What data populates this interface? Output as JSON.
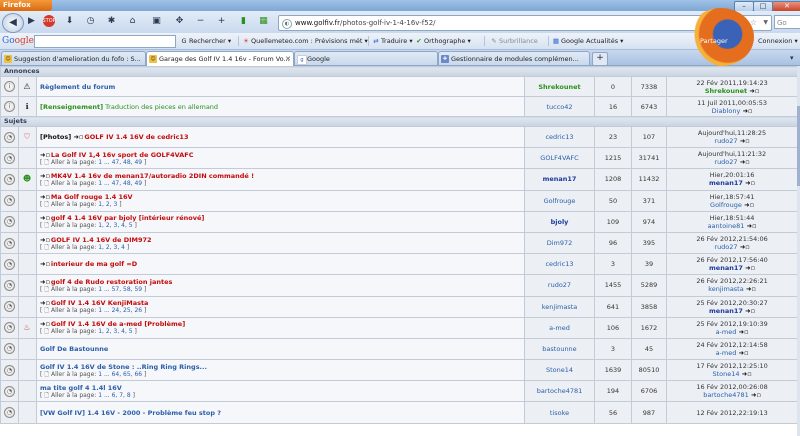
{
  "window": {
    "app_button": "Firefox",
    "minimize": "–",
    "maximize": "□",
    "close": "✕"
  },
  "nav": {
    "url_host": "www.golfiv.fr",
    "url_path": "/photos-golf-iv-1-4-16v-f52/",
    "search_placeholder": "Go"
  },
  "google_toolbar": {
    "logo_g": "Go",
    "logo_rest": "ogle",
    "search_value": "",
    "items": [
      {
        "icon": "G",
        "label": "Rechercher ▾"
      },
      {
        "icon": "☀",
        "label": "Quellemeteo.com : Prévisions mét ▾"
      },
      {
        "icon": "⇄",
        "label": "Traduire ▾"
      },
      {
        "icon": "✔",
        "label": "Orthographe ▾"
      },
      {
        "icon": "✎",
        "label": "Surbrillance"
      },
      {
        "icon": "▦",
        "label": "Google Actualités ▾"
      }
    ],
    "profile_label": "Partager",
    "connexion": "Connexion ▾"
  },
  "tabs": [
    {
      "label": "Suggestion d'amelioration du fofo : S...",
      "active": false
    },
    {
      "label": "Garage des Golf IV 1.4 16v - Forum Vo...",
      "active": true
    },
    {
      "label": "Google",
      "active": false
    },
    {
      "label": "Gestionnaire de modules complémen...",
      "active": false
    }
  ],
  "forum": {
    "announce_header": "Annonces",
    "subjects_header": "Sujets",
    "announcements": [
      {
        "icon_type": "⚠",
        "title": "Règlement du forum",
        "title_style": "blue",
        "desc": "",
        "author": "Shrekounet",
        "author_style": "au2",
        "replies": "0",
        "views": "7338",
        "last_date": "22 Fév 2011,19:14:23",
        "last_user": "Shrekounet",
        "last_style": "au2"
      },
      {
        "icon_type": "ℹ",
        "title": "[Renseignement]",
        "title_style": "green",
        "desc": "Traduction des pieces en allemand",
        "author": "tucco42",
        "author_style": "plain",
        "replies": "16",
        "views": "6743",
        "last_date": "11 Juil 2011,00:05:53",
        "last_user": "Diablony",
        "last_style": "plain"
      }
    ],
    "topics": [
      {
        "icon_type": "♡",
        "prefix": "[Photos] ",
        "title": "GOLF IV 1.4 16V de cedric13",
        "pages": "",
        "author": "cedric13",
        "author_style": "plain",
        "replies": "23",
        "views": "107",
        "last_date": "Aujourd'hui,11:28:25",
        "last_user": "rudo27",
        "last_style": "plain"
      },
      {
        "icon_type": "",
        "prefix": "",
        "title": "La Golf IV 1,4 16v sport de GOLF4VAFC",
        "pages": "1 ... 47, 48, 49",
        "author": "GOLF4VAFC",
        "author_style": "plain",
        "replies": "1215",
        "views": "31741",
        "last_date": "Aujourd'hui,11:21:32",
        "last_user": "rudo27",
        "last_style": "plain"
      },
      {
        "icon_type": "☻",
        "prefix": "",
        "title": "MK4V 1.4 16v de menan17/autoradio 2DIN commandé !",
        "pages": "1 ... 47, 48, 49",
        "author": "menan17",
        "author_style": "bold",
        "replies": "1208",
        "views": "11432",
        "last_date": "Hier,20:01:16",
        "last_user": "menan17",
        "last_style": "bold"
      },
      {
        "icon_type": "",
        "prefix": "",
        "title": "Ma Golf rouge 1.4 16V",
        "pages": "1, 2, 3",
        "author": "Golfrouge",
        "author_style": "plain",
        "replies": "50",
        "views": "371",
        "last_date": "Hier,18:57:41",
        "last_user": "Golfrouge",
        "last_style": "plain"
      },
      {
        "icon_type": "",
        "prefix": "",
        "title": "golf 4 1.4 16V par bjoly [intérieur rénové]",
        "pages": "1, 2, 3, 4, 5",
        "author": "bjoly",
        "author_style": "bold",
        "replies": "109",
        "views": "974",
        "last_date": "Hier,18:51:44",
        "last_user": "aantoine81",
        "last_style": "plain"
      },
      {
        "icon_type": "",
        "prefix": "",
        "title": "GOLF IV 1.4 16V de DIM972",
        "pages": "1, 2, 3, 4",
        "author": "Dim972",
        "author_style": "plain",
        "replies": "96",
        "views": "395",
        "last_date": "26 Fév 2012,21:54:06",
        "last_user": "rudo27",
        "last_style": "plain"
      },
      {
        "icon_type": "",
        "prefix": "",
        "title": "interieur de ma golf =D",
        "pages": "",
        "author": "cedric13",
        "author_style": "plain",
        "replies": "3",
        "views": "39",
        "last_date": "26 Fév 2012,17:56:40",
        "last_user": "menan17",
        "last_style": "bold"
      },
      {
        "icon_type": "",
        "prefix": "",
        "title": "golf 4 de Rudo restoration jantes",
        "pages": "1 ... 57, 58, 59",
        "author": "rudo27",
        "author_style": "plain",
        "replies": "1455",
        "views": "5289",
        "last_date": "26 Fév 2012,22:26:21",
        "last_user": "kenjimasta",
        "last_style": "plain"
      },
      {
        "icon_type": "",
        "prefix": "",
        "title": "Golf IV 1.4 16V KenjiMasta",
        "pages": "1 ... 24, 25, 26",
        "author": "kenjimasta",
        "author_style": "plain",
        "replies": "641",
        "views": "3858",
        "last_date": "25 Fév 2012,20:30:27",
        "last_user": "menan17",
        "last_style": "bold"
      },
      {
        "icon_type": "♨",
        "prefix": "",
        "title": "Golf IV 1.4 16V de a-med [Problème]",
        "pages": "1, 2, 3, 4, 5",
        "author": "a-med",
        "author_style": "plain",
        "replies": "106",
        "views": "1672",
        "last_date": "25 Fév 2012,19:10:39",
        "last_user": "a-med",
        "last_style": "plain"
      },
      {
        "icon_type": "",
        "prefix": "",
        "title": "Golf De Bastounne",
        "pages": "",
        "title_style": "blue",
        "author": "bastounne",
        "author_style": "plain",
        "replies": "3",
        "views": "45",
        "last_date": "24 Fév 2012,12:14:58",
        "last_user": "a-med",
        "last_style": "plain"
      },
      {
        "icon_type": "",
        "prefix": "",
        "title": "Golf IV 1.4 16V de Stone : ..Ring Ring Rings...",
        "pages": "1 ... 64, 65, 66",
        "title_style": "blue",
        "author": "Stone14",
        "author_style": "plain",
        "replies": "1639",
        "views": "80510",
        "last_date": "17 Fév 2012,12:25:10",
        "last_user": "Stone14",
        "last_style": "plain"
      },
      {
        "icon_type": "",
        "prefix": "",
        "title": "ma tite golf 4 1.4l 16V",
        "pages": "1 ... 6, 7, 8",
        "title_style": "blue",
        "author": "bartoche4781",
        "author_style": "plain",
        "replies": "194",
        "views": "6706",
        "last_date": "16 Fév 2012,00:26:08",
        "last_user": "bartoche4781",
        "last_style": "plain"
      },
      {
        "icon_type": "",
        "prefix": "",
        "title": "[VW Golf IV] 1.4 16V - 2000 - Problème feu stop ?",
        "pages": "",
        "title_style": "blue",
        "author": "tisoke",
        "author_style": "plain",
        "replies": "56",
        "views": "987",
        "last_date": "12 Fév 2012,22:19:13",
        "last_user": "",
        "last_style": "plain"
      }
    ],
    "pages_prefix": "[ 🗋 Aller à la page: ",
    "pages_suffix": " ]"
  },
  "colors": {
    "accent_blue": "#2a5ea8",
    "topic_red": "#c40a0a",
    "green": "#2b8f1e"
  }
}
